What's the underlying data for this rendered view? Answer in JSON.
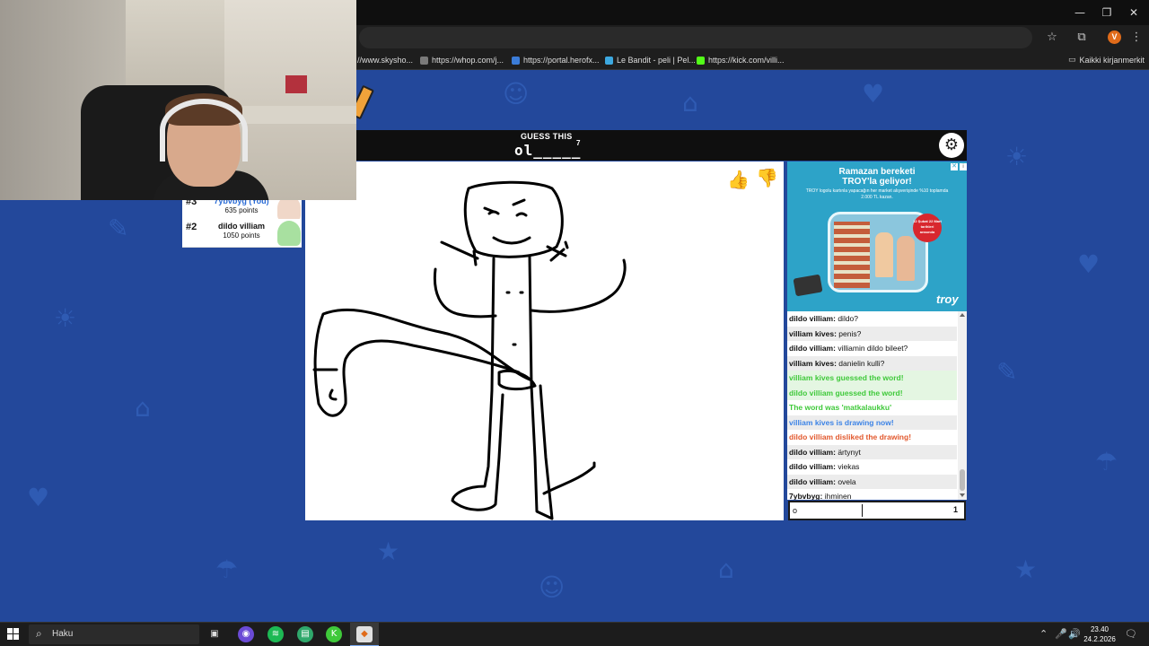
{
  "browser": {
    "bookmarks": [
      {
        "label": "//www.skysho...",
        "color": "#e6e6e6"
      },
      {
        "label": "https://whop.com/j...",
        "color": "#7a7a7a"
      },
      {
        "label": "https://portal.herofx...",
        "color": "#3b7cd8"
      },
      {
        "label": "Le Bandit - peli | Pel...",
        "color": "#3ca8e0"
      },
      {
        "label": "https://kick.com/villi...",
        "color": "#53fc18"
      }
    ],
    "bookmarks_folder": "Kaikki kirjanmerkit",
    "profile_initial": "V"
  },
  "game": {
    "guess_label": "GUESS THIS",
    "word_hint": "ol_____",
    "letter_count": "7",
    "players": [
      {
        "rank": "#3",
        "name": "7ybvbyg (You)",
        "points": "635 points",
        "you": true,
        "avatar_color": "#f0d7c8"
      },
      {
        "rank": "#2",
        "name": "dildo villiam",
        "points": "1050 points",
        "you": false,
        "avatar_color": "#a8e0a0"
      }
    ],
    "chat": [
      {
        "who": "dildo villiam:",
        "text": "dildo?",
        "type": "msg"
      },
      {
        "who": "villiam kives:",
        "text": "penis?",
        "type": "msg"
      },
      {
        "who": "dildo villiam:",
        "text": "villiamin dildo bileet?",
        "type": "msg"
      },
      {
        "who": "villiam kives:",
        "text": "danielin kulli?",
        "type": "msg"
      },
      {
        "who": "",
        "text": "villiam kives guessed the word!",
        "type": "green"
      },
      {
        "who": "",
        "text": "dildo villiam guessed the word!",
        "type": "green"
      },
      {
        "who": "",
        "text": "The word was 'matkalaukku'",
        "type": "green-plain"
      },
      {
        "who": "",
        "text": "villiam kives is drawing now!",
        "type": "blue"
      },
      {
        "who": "",
        "text": "dildo villiam disliked the drawing!",
        "type": "orange"
      },
      {
        "who": "dildo villiam:",
        "text": "ärtynyt",
        "type": "msg"
      },
      {
        "who": "dildo villiam:",
        "text": "viekas",
        "type": "msg"
      },
      {
        "who": "dildo villiam:",
        "text": "ovela",
        "type": "msg"
      },
      {
        "who": "7ybvbyg:",
        "text": "ihminen",
        "type": "msg"
      }
    ],
    "chat_input_value": "o",
    "chat_char_count": "1"
  },
  "ad": {
    "title_line1": "Ramazan bereketi",
    "title_line2": "TROY'la geliyor!",
    "body": "TROY logolu kartınla yapacağın her market alışverişinde %10 toplamda 2.000 TL kazan.",
    "badge": "12 Şubat 22 Mart tarihleri arasında",
    "brand": "troy",
    "close_label": "✕",
    "info_label": "i"
  },
  "taskbar": {
    "search_label": "Haku",
    "time": "23.40",
    "date": "24.2.2026"
  }
}
